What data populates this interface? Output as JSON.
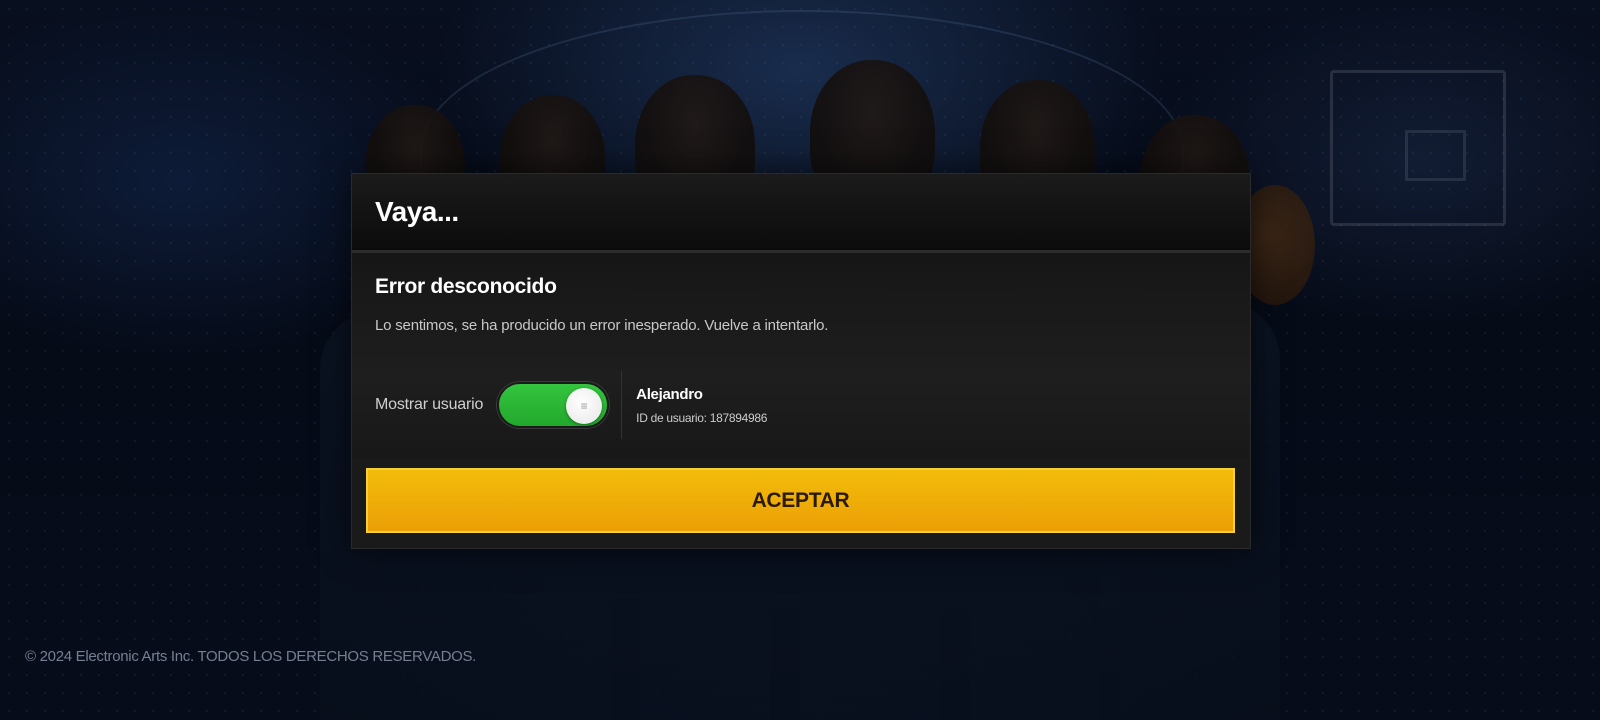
{
  "dialog": {
    "title": "Vaya...",
    "error_title": "Error desconocido",
    "error_message": "Lo sentimos, se ha producido un error inesperado. Vuelve a intentarlo.",
    "toggle_label": "Mostrar usuario",
    "toggle_on": true,
    "username": "Alejandro",
    "user_id": "ID de usuario: 187894986",
    "accept_label": "ACEPTAR"
  },
  "footer": {
    "copyright": "© 2024 Electronic Arts Inc. TODOS LOS DERECHOS RESERVADOS."
  },
  "colors": {
    "accent_button": "#f0b208",
    "toggle_on": "#2bb835",
    "dialog_bg": "#141414"
  },
  "icons": {
    "toggle_knob": "grip-lines-icon"
  }
}
